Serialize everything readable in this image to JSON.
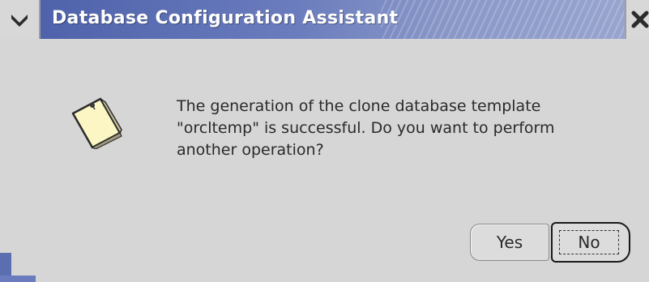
{
  "window": {
    "title": "Database Configuration Assistant"
  },
  "icons": {
    "menu": "chevron-down-icon",
    "close": "close-icon",
    "note": "note-icon"
  },
  "message": {
    "lines": [
      "The generation of the clone database template",
      "\"orcltemp\" is successful. Do you want to perform",
      "another operation?"
    ]
  },
  "buttons": {
    "yes_label": "Yes",
    "no_label": "No"
  },
  "colors": {
    "titlebar": "#4a5ea8",
    "background": "#d6d6d6"
  }
}
